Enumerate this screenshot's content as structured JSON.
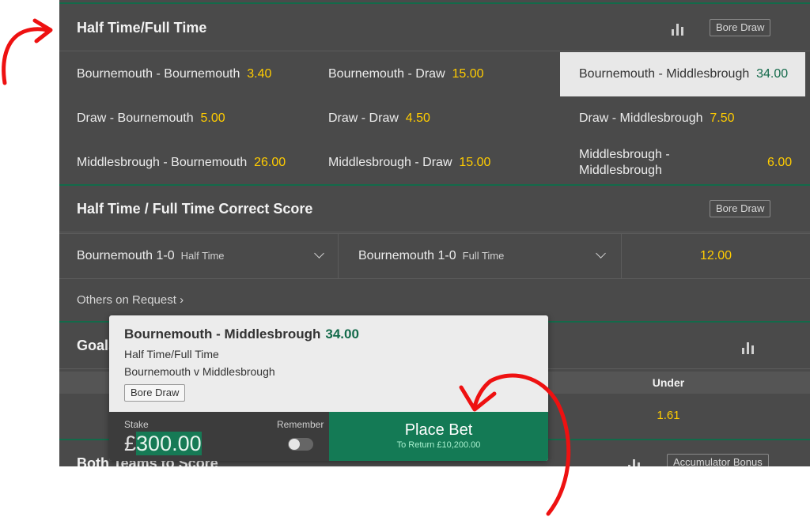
{
  "htft": {
    "title": "Half Time/Full Time",
    "tag": "Bore Draw",
    "selections": [
      {
        "label": "Bournemouth - Bournemouth",
        "odds": "3.40"
      },
      {
        "label": "Bournemouth - Draw",
        "odds": "15.00"
      },
      {
        "label": "Bournemouth - Middlesbrough",
        "odds": "34.00"
      },
      {
        "label": "Draw - Bournemouth",
        "odds": "5.00"
      },
      {
        "label": "Draw - Draw",
        "odds": "4.50"
      },
      {
        "label": "Draw - Middlesbrough",
        "odds": "7.50"
      },
      {
        "label": "Middlesbrough - Bournemouth",
        "odds": "26.00"
      },
      {
        "label": "Middlesbrough - Draw",
        "odds": "15.00"
      },
      {
        "label_line1": "Middlesbrough -",
        "label_line2": "Middlesbrough",
        "odds": "6.00"
      }
    ]
  },
  "htft_cs": {
    "title": "Half Time / Full Time Correct Score",
    "tag": "Bore Draw",
    "half_time_select": {
      "value": "Bournemouth 1-0",
      "suffix": "Half Time"
    },
    "full_time_select": {
      "value": "Bournemouth 1-0",
      "suffix": "Full Time"
    },
    "odds": "12.00",
    "others_link": "Others on Request ›"
  },
  "goals": {
    "title_partial": "Goals",
    "column_under": "Under",
    "under_odds": "1.61"
  },
  "btts": {
    "title_partial": "Both Teams to Score",
    "tag": "Accumulator Bonus"
  },
  "bet_slip": {
    "selection": "Bournemouth - Middlesbrough",
    "odds": "34.00",
    "market": "Half Time/Full Time",
    "event": "Bournemouth v Middlesbrough",
    "tag": "Bore Draw",
    "stake_label": "Stake",
    "currency": "£",
    "stake_value": "300.00",
    "remember_label": "Remember",
    "place_bet_label": "Place Bet",
    "to_return": "To Return £10,200.00"
  },
  "colors": {
    "page_bg": "#4a4a4a",
    "odds_yellow": "#ffcc00",
    "brand_green": "#136a4a",
    "place_bet_green": "#147a55",
    "annotation_red": "#ee1111"
  }
}
